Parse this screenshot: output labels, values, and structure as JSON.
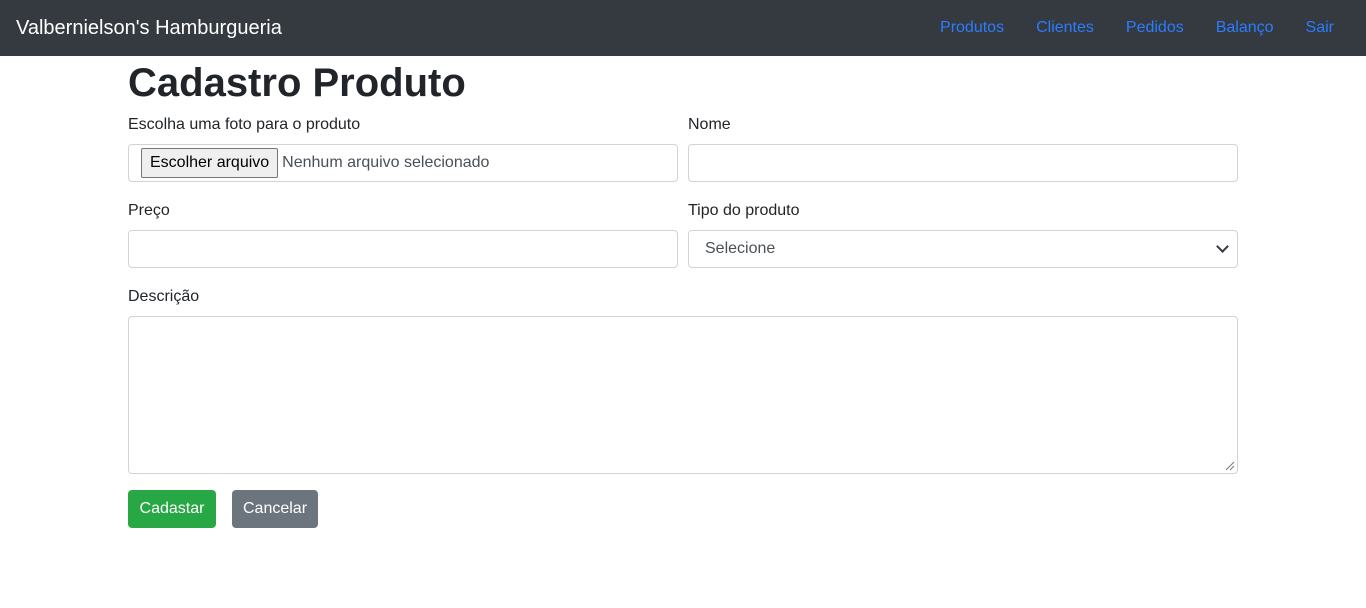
{
  "navbar": {
    "brand": "Valbernielson's Hamburgueria",
    "links": [
      "Produtos",
      "Clientes",
      "Pedidos",
      "Balanço",
      "Sair"
    ],
    "link_color": "#2b7cff",
    "background": "#343a40"
  },
  "page": {
    "title": "Cadastro Produto"
  },
  "form": {
    "photo_label": "Escolha uma foto para o produto",
    "photo_button": "Escolher arquivo",
    "photo_status": "Nenhum arquivo selecionado",
    "name_label": "Nome",
    "name_value": "",
    "price_label": "Preço",
    "price_value": "",
    "type_label": "Tipo do produto",
    "type_selected": "Selecione",
    "description_label": "Descrição",
    "description_value": ""
  },
  "actions": {
    "submit": "Cadastar",
    "cancel": "Cancelar",
    "submit_color": "#28a745",
    "cancel_color": "#6c757d"
  }
}
